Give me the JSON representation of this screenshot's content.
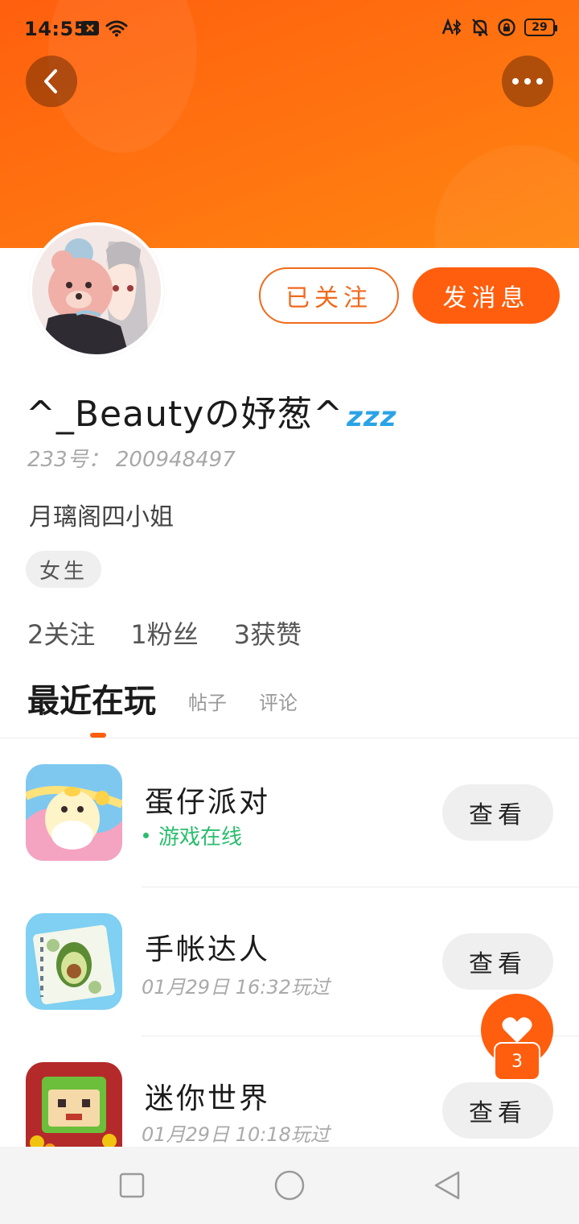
{
  "status_bar": {
    "time": "14:55",
    "battery": "29",
    "left_icons": [
      "notification-x-icon",
      "wifi-icon"
    ],
    "right_icons": [
      "bluetooth-icon",
      "mute-bell-icon",
      "rotation-lock-icon",
      "battery-icon"
    ]
  },
  "header": {
    "back_icon": "chevron-left-icon",
    "more_icon": "more-dots-icon",
    "banner_color": "#ff6a10"
  },
  "profile": {
    "follow_label": "已关注",
    "message_label": "发消息",
    "username": "^_Beautyの妤葱^",
    "username_badge": "zzz",
    "id_text": "233号： 200948497",
    "bio": "月璃阁四小姐",
    "gender_tag": "女生",
    "stats": {
      "following": "2关注",
      "followers": "1粉丝",
      "likes": "3获赞"
    }
  },
  "tabs": {
    "recent": "最近在玩",
    "posts": "帖子",
    "comments": "评论"
  },
  "games": [
    {
      "name": "蛋仔派对",
      "status": "游戏在线",
      "online": true,
      "action": "查看"
    },
    {
      "name": "手帐达人",
      "status": "01月29日 16:32玩过",
      "online": false,
      "action": "查看"
    },
    {
      "name": "迷你世界",
      "status": "01月29日 10:18玩过",
      "online": false,
      "action": "查看"
    }
  ],
  "like_fab": {
    "icon": "heart-icon",
    "count": "3"
  },
  "nav_bar": {
    "icons": [
      "recent-apps-icon",
      "home-icon",
      "back-icon"
    ]
  },
  "colors": {
    "accent": "#ff5e0e",
    "online_green": "#2bbd6e"
  }
}
